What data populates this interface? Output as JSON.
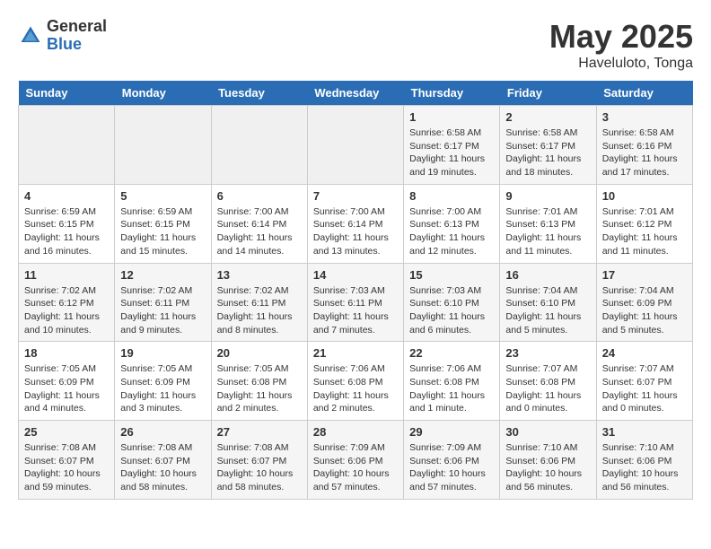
{
  "logo": {
    "general": "General",
    "blue": "Blue"
  },
  "title": "May 2025",
  "location": "Haveluloto, Tonga",
  "days_of_week": [
    "Sunday",
    "Monday",
    "Tuesday",
    "Wednesday",
    "Thursday",
    "Friday",
    "Saturday"
  ],
  "weeks": [
    [
      {
        "day": "",
        "info": ""
      },
      {
        "day": "",
        "info": ""
      },
      {
        "day": "",
        "info": ""
      },
      {
        "day": "",
        "info": ""
      },
      {
        "day": "1",
        "info": "Sunrise: 6:58 AM\nSunset: 6:17 PM\nDaylight: 11 hours\nand 19 minutes."
      },
      {
        "day": "2",
        "info": "Sunrise: 6:58 AM\nSunset: 6:17 PM\nDaylight: 11 hours\nand 18 minutes."
      },
      {
        "day": "3",
        "info": "Sunrise: 6:58 AM\nSunset: 6:16 PM\nDaylight: 11 hours\nand 17 minutes."
      }
    ],
    [
      {
        "day": "4",
        "info": "Sunrise: 6:59 AM\nSunset: 6:15 PM\nDaylight: 11 hours\nand 16 minutes."
      },
      {
        "day": "5",
        "info": "Sunrise: 6:59 AM\nSunset: 6:15 PM\nDaylight: 11 hours\nand 15 minutes."
      },
      {
        "day": "6",
        "info": "Sunrise: 7:00 AM\nSunset: 6:14 PM\nDaylight: 11 hours\nand 14 minutes."
      },
      {
        "day": "7",
        "info": "Sunrise: 7:00 AM\nSunset: 6:14 PM\nDaylight: 11 hours\nand 13 minutes."
      },
      {
        "day": "8",
        "info": "Sunrise: 7:00 AM\nSunset: 6:13 PM\nDaylight: 11 hours\nand 12 minutes."
      },
      {
        "day": "9",
        "info": "Sunrise: 7:01 AM\nSunset: 6:13 PM\nDaylight: 11 hours\nand 11 minutes."
      },
      {
        "day": "10",
        "info": "Sunrise: 7:01 AM\nSunset: 6:12 PM\nDaylight: 11 hours\nand 11 minutes."
      }
    ],
    [
      {
        "day": "11",
        "info": "Sunrise: 7:02 AM\nSunset: 6:12 PM\nDaylight: 11 hours\nand 10 minutes."
      },
      {
        "day": "12",
        "info": "Sunrise: 7:02 AM\nSunset: 6:11 PM\nDaylight: 11 hours\nand 9 minutes."
      },
      {
        "day": "13",
        "info": "Sunrise: 7:02 AM\nSunset: 6:11 PM\nDaylight: 11 hours\nand 8 minutes."
      },
      {
        "day": "14",
        "info": "Sunrise: 7:03 AM\nSunset: 6:11 PM\nDaylight: 11 hours\nand 7 minutes."
      },
      {
        "day": "15",
        "info": "Sunrise: 7:03 AM\nSunset: 6:10 PM\nDaylight: 11 hours\nand 6 minutes."
      },
      {
        "day": "16",
        "info": "Sunrise: 7:04 AM\nSunset: 6:10 PM\nDaylight: 11 hours\nand 5 minutes."
      },
      {
        "day": "17",
        "info": "Sunrise: 7:04 AM\nSunset: 6:09 PM\nDaylight: 11 hours\nand 5 minutes."
      }
    ],
    [
      {
        "day": "18",
        "info": "Sunrise: 7:05 AM\nSunset: 6:09 PM\nDaylight: 11 hours\nand 4 minutes."
      },
      {
        "day": "19",
        "info": "Sunrise: 7:05 AM\nSunset: 6:09 PM\nDaylight: 11 hours\nand 3 minutes."
      },
      {
        "day": "20",
        "info": "Sunrise: 7:05 AM\nSunset: 6:08 PM\nDaylight: 11 hours\nand 2 minutes."
      },
      {
        "day": "21",
        "info": "Sunrise: 7:06 AM\nSunset: 6:08 PM\nDaylight: 11 hours\nand 2 minutes."
      },
      {
        "day": "22",
        "info": "Sunrise: 7:06 AM\nSunset: 6:08 PM\nDaylight: 11 hours\nand 1 minute."
      },
      {
        "day": "23",
        "info": "Sunrise: 7:07 AM\nSunset: 6:08 PM\nDaylight: 11 hours\nand 0 minutes."
      },
      {
        "day": "24",
        "info": "Sunrise: 7:07 AM\nSunset: 6:07 PM\nDaylight: 11 hours\nand 0 minutes."
      }
    ],
    [
      {
        "day": "25",
        "info": "Sunrise: 7:08 AM\nSunset: 6:07 PM\nDaylight: 10 hours\nand 59 minutes."
      },
      {
        "day": "26",
        "info": "Sunrise: 7:08 AM\nSunset: 6:07 PM\nDaylight: 10 hours\nand 58 minutes."
      },
      {
        "day": "27",
        "info": "Sunrise: 7:08 AM\nSunset: 6:07 PM\nDaylight: 10 hours\nand 58 minutes."
      },
      {
        "day": "28",
        "info": "Sunrise: 7:09 AM\nSunset: 6:06 PM\nDaylight: 10 hours\nand 57 minutes."
      },
      {
        "day": "29",
        "info": "Sunrise: 7:09 AM\nSunset: 6:06 PM\nDaylight: 10 hours\nand 57 minutes."
      },
      {
        "day": "30",
        "info": "Sunrise: 7:10 AM\nSunset: 6:06 PM\nDaylight: 10 hours\nand 56 minutes."
      },
      {
        "day": "31",
        "info": "Sunrise: 7:10 AM\nSunset: 6:06 PM\nDaylight: 10 hours\nand 56 minutes."
      }
    ]
  ]
}
